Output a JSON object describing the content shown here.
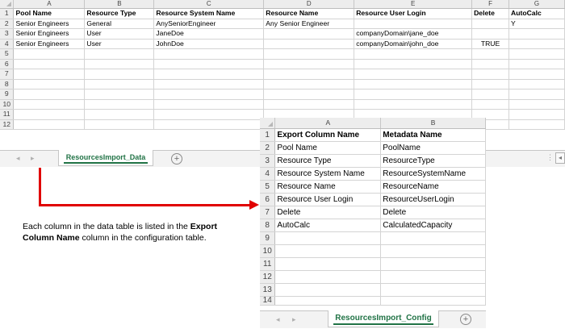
{
  "sheet1": {
    "col_letters": [
      "A",
      "B",
      "C",
      "D",
      "E",
      "F",
      "G"
    ],
    "row_numbers": [
      "1",
      "2",
      "3",
      "4",
      "5",
      "6",
      "7",
      "8",
      "9",
      "10",
      "11",
      "12"
    ],
    "headers": [
      "Pool Name",
      "Resource Type",
      "Resource System Name",
      "Resource Name",
      "Resource User Login",
      "Delete",
      "AutoCalc"
    ],
    "rows": [
      [
        "Senior Engineers",
        "General",
        "AnySeniorEngineer",
        "Any Senior Engineer",
        "",
        "",
        "Y"
      ],
      [
        "Senior Engineers",
        "User",
        "JaneDoe",
        "",
        "companyDomain\\jane_doe",
        "",
        ""
      ],
      [
        "Senior Engineers",
        "User",
        "JohnDoe",
        "",
        "companyDomain\\john_doe",
        "TRUE",
        ""
      ]
    ],
    "tab_label": "ResourcesImport_Data",
    "add_sheet_icon": "plus-circle-icon"
  },
  "sheet2": {
    "col_letters": [
      "A",
      "B"
    ],
    "row_numbers": [
      "1",
      "2",
      "3",
      "4",
      "5",
      "6",
      "7",
      "8",
      "9",
      "10",
      "11",
      "12",
      "13",
      "14"
    ],
    "headers": [
      "Export Column Name",
      "Metadata Name"
    ],
    "rows": [
      [
        "Pool Name",
        "PoolName"
      ],
      [
        "Resource Type",
        "ResourceType"
      ],
      [
        "Resource System Name",
        "ResourceSystemName"
      ],
      [
        "Resource Name",
        "ResourceName"
      ],
      [
        "Resource User Login",
        "ResourceUserLogin"
      ],
      [
        "Delete",
        "Delete"
      ],
      [
        "AutoCalc",
        "CalculatedCapacity"
      ]
    ],
    "tab_label": "ResourcesImport_Config",
    "add_sheet_icon": "plus-circle-icon"
  },
  "annotation": {
    "text_1": "Each column in the data table is listed in the ",
    "bold_1": "Export Column Name",
    "text_2": " column in the configuration table.",
    "arrow_color": "#e00000"
  },
  "colors": {
    "tab_green": "#217346",
    "header_gray": "#ededed",
    "grid_line": "#d4d4d4"
  }
}
